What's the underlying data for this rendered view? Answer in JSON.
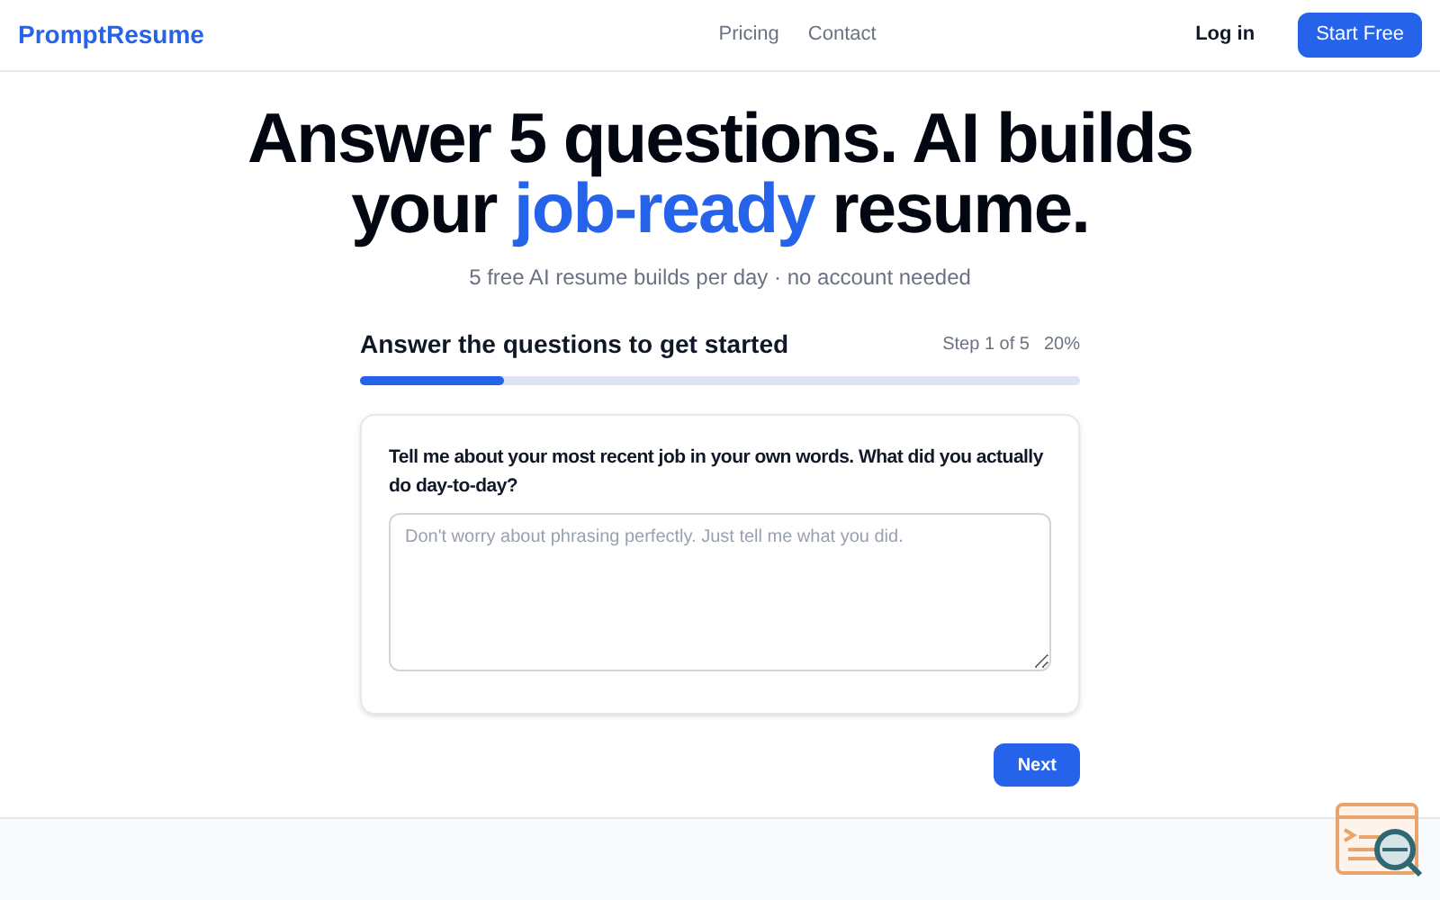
{
  "nav": {
    "logo": "PromptResume",
    "links": [
      "Pricing",
      "Contact"
    ],
    "login": "Log in",
    "cta": "Start Free"
  },
  "hero": {
    "headline": [
      {
        "text": "Answer 5 questions. AI builds your ",
        "accent": false
      },
      {
        "text": "job-ready",
        "accent": true
      },
      {
        "text": " resume.",
        "accent": false
      }
    ],
    "subtitle": "5 free AI resume builds per day · no account needed"
  },
  "progress": {
    "title": "Answer the questions to get started",
    "step": "Step 1 of 5",
    "percent": "20%",
    "level": 0.2
  },
  "question": {
    "prompt": "Tell me about your most recent job in your own words. What did you actually do day-to-day?",
    "placeholder": "Don't worry about phrasing perfectly. Just tell me what you did."
  },
  "next_button": "Next"
}
